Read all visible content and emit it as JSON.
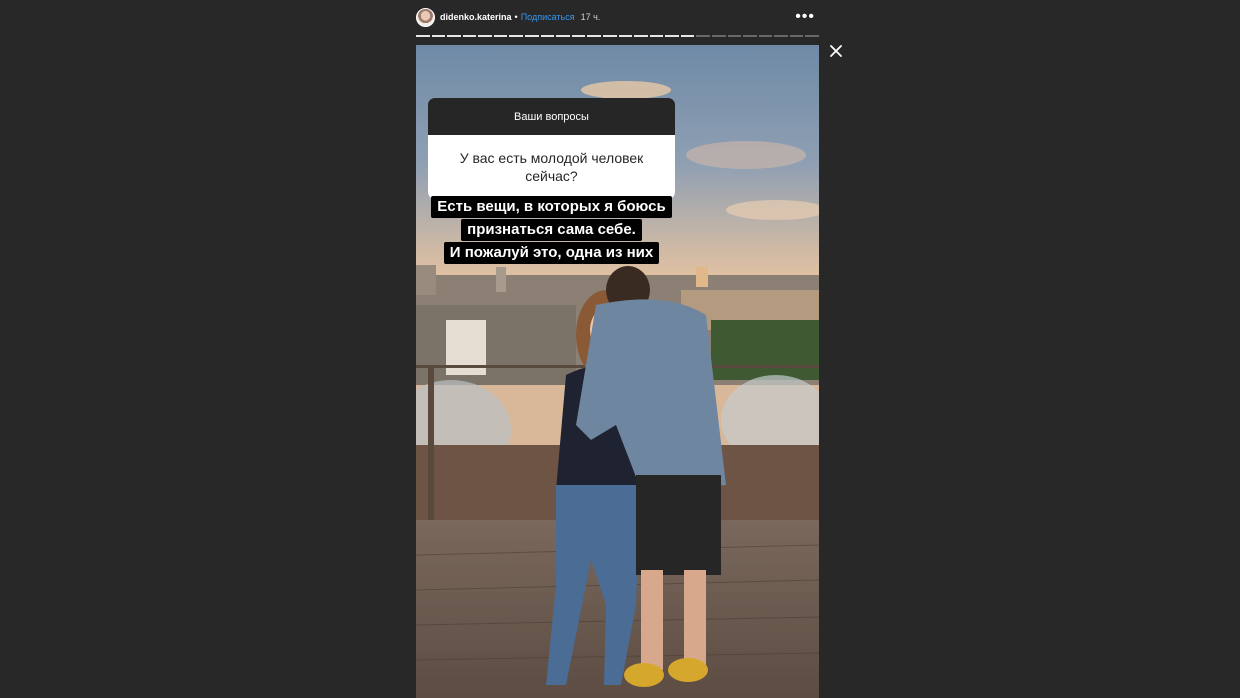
{
  "header": {
    "username": "didenko.katerina",
    "separator": "•",
    "follow_label": "Подписаться",
    "time": "17 ч.",
    "more_icon": "more-dots-icon"
  },
  "progress": {
    "segments_total": 26,
    "segments_viewed": 18
  },
  "close_icon": "close-icon",
  "question_sticker": {
    "title": "Ваши вопросы",
    "question": "У вас есть молодой человек сейчас?"
  },
  "answer": {
    "lines": [
      "Есть вещи, в которых я боюсь",
      "признаться сама себе.",
      "И пожалуй это, одна из них"
    ]
  },
  "colors": {
    "background": "#282828",
    "link": "#3897f0",
    "sticker_dark": "#262626"
  }
}
